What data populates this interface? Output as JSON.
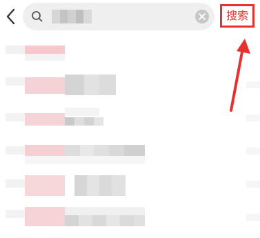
{
  "header": {
    "back_icon": "chevron-left-icon",
    "search": {
      "icon": "search-icon",
      "clear_icon": "close-icon"
    },
    "search_button_label": "搜索"
  },
  "annotation": {
    "highlight_color": "#e8312f",
    "arrow_icon": "arrow-up-icon"
  },
  "suggestions_count": 6
}
